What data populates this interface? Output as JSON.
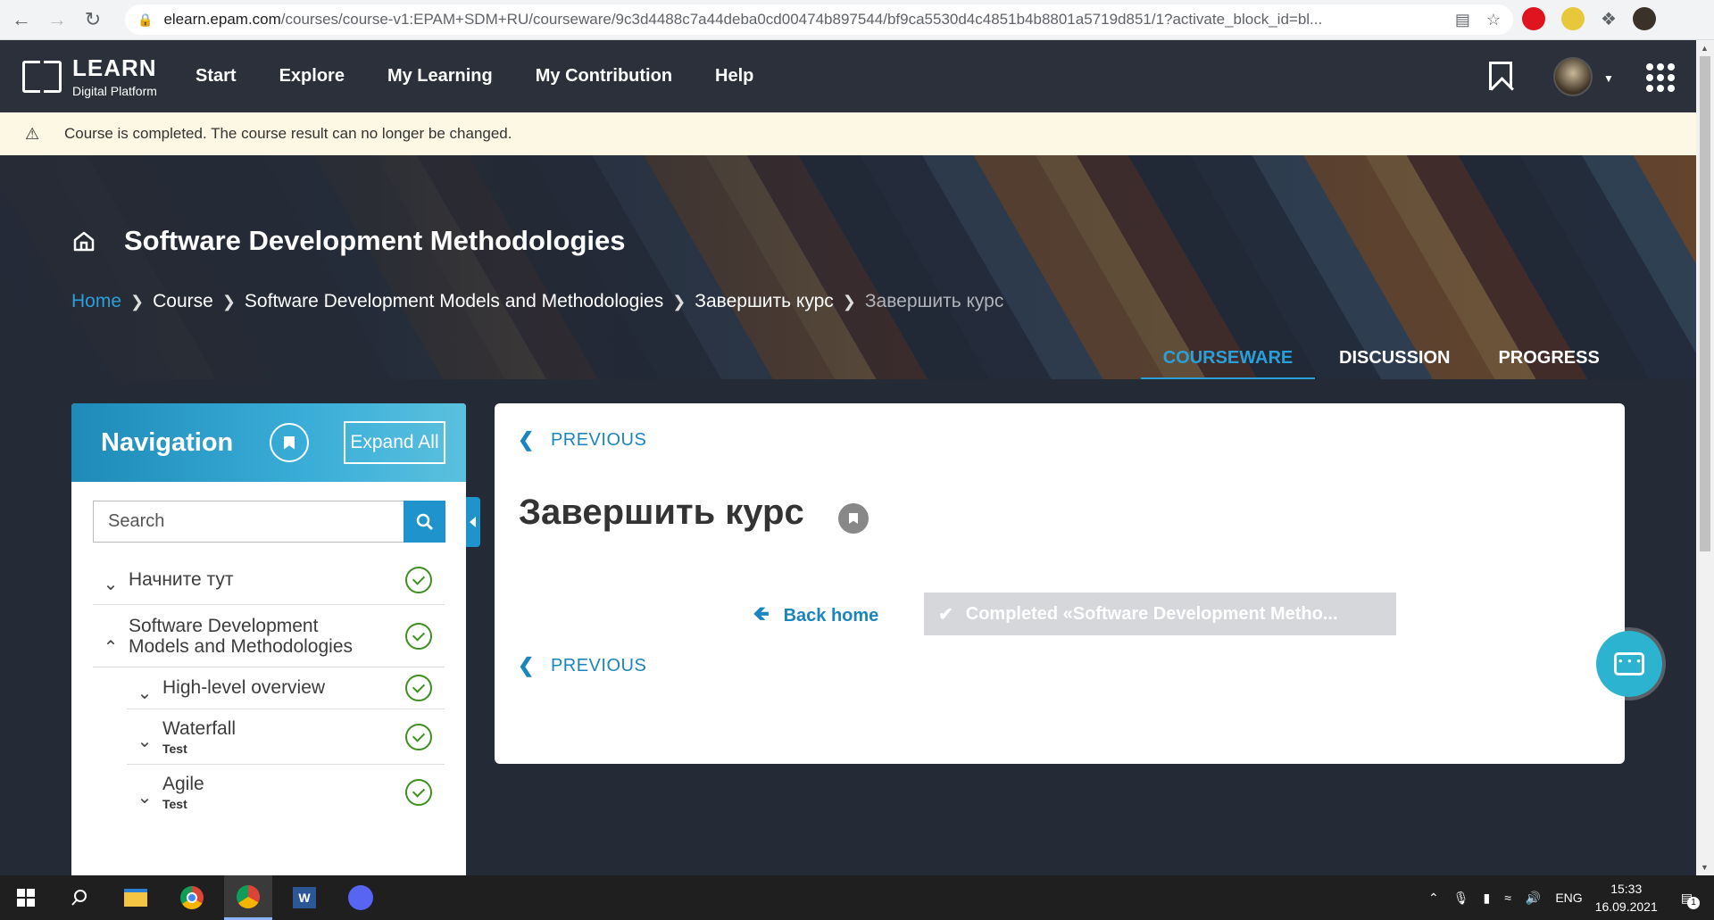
{
  "browser": {
    "url_host": "elearn.epam.com",
    "url_path": "/courses/course-v1:EPAM+SDM+RU/courseware/9c3d4488c7a44deba0cd00474b897544/bf9ca5530d4c4851b4b8801a5719d851/1?activate_block_id=bl..."
  },
  "header": {
    "logo_title": "LEARN",
    "logo_subtitle": "Digital Platform",
    "nav": [
      "Start",
      "Explore",
      "My Learning",
      "My Contribution",
      "Help"
    ]
  },
  "banner": {
    "text": "Course is completed. The course result can no longer be changed."
  },
  "hero": {
    "course_title": "Software Development Methodologies",
    "breadcrumbs": [
      "Home",
      "Course",
      "Software Development Models and Methodologies",
      "Завершить курс",
      "Завершить курс"
    ],
    "tabs": [
      "COURSEWARE",
      "DISCUSSION",
      "PROGRESS"
    ]
  },
  "navigation": {
    "title": "Navigation",
    "expand_label": "Expand All",
    "search_placeholder": "Search",
    "items": [
      {
        "label": "Начните тут",
        "sub": ""
      },
      {
        "label": "Software Development Models and Methodologies",
        "sub": ""
      },
      {
        "label": "High-level overview",
        "sub": ""
      },
      {
        "label": "Waterfall",
        "sub": "Test"
      },
      {
        "label": "Agile",
        "sub": "Test"
      }
    ]
  },
  "content": {
    "previous_label": "PREVIOUS",
    "unit_title": "Завершить курс",
    "back_home_label": "Back home",
    "completed_label": "Completed  «Software Development Metho..."
  },
  "taskbar": {
    "lang": "ENG",
    "time": "15:33",
    "date": "16.09.2021",
    "notifications": "1"
  },
  "colors": {
    "accent": "#1f93cb",
    "header_bg": "#2b303b",
    "banner_bg": "#fdf8e3",
    "check_green": "#3f8f1f"
  }
}
